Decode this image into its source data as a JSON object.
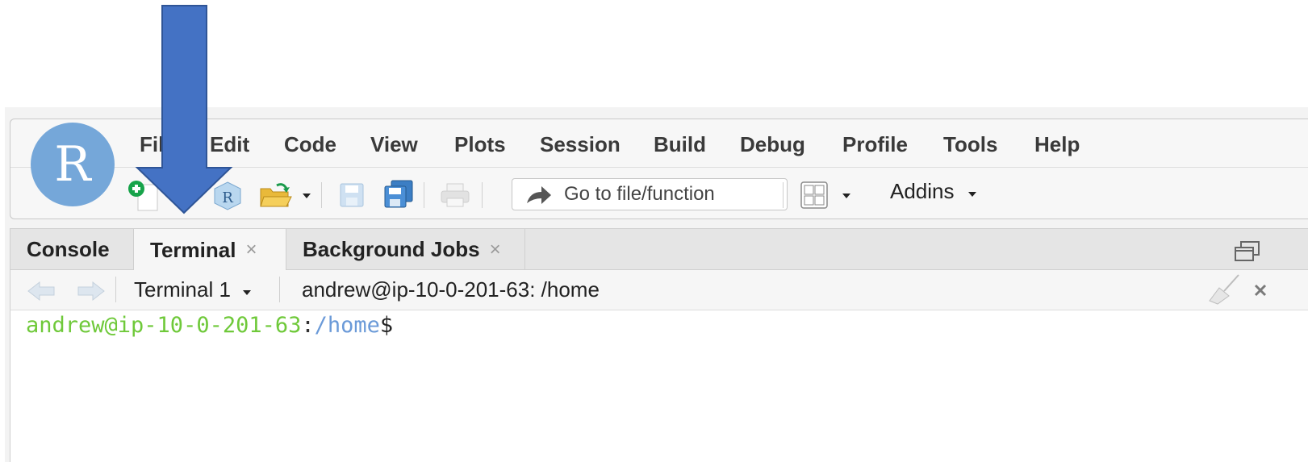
{
  "app": {
    "logo_letter": "R",
    "logo_color": "#75a7d9"
  },
  "menu": {
    "items": [
      "File",
      "Edit",
      "Code",
      "View",
      "Plots",
      "Session",
      "Build",
      "Debug",
      "Profile",
      "Tools",
      "Help"
    ]
  },
  "toolbar": {
    "goto_placeholder": "Go to file/function",
    "addins_label": "Addins",
    "icons": [
      "new-file-icon",
      "r-project-icon",
      "open-folder-icon",
      "save-icon",
      "save-all-icon",
      "print-icon",
      "grid-layout-icon"
    ]
  },
  "tabs": [
    {
      "label": "Console",
      "closable": false,
      "active": false
    },
    {
      "label": "Terminal",
      "closable": true,
      "active": true
    },
    {
      "label": "Background Jobs",
      "closable": true,
      "active": false
    }
  ],
  "tab_close_glyph": "×",
  "terminal_bar": {
    "session_label": "Terminal 1",
    "title": "andrew@ip-10-0-201-63: /home"
  },
  "terminal": {
    "prompt_user": "andrew@ip-10-0-201-63",
    "prompt_sep": ":",
    "prompt_path": "/home",
    "prompt_symbol": "$"
  },
  "colors": {
    "prompt_user": "#6fc93a",
    "prompt_path": "#6b9ad8",
    "annotation_arrow": "#4472c4"
  }
}
